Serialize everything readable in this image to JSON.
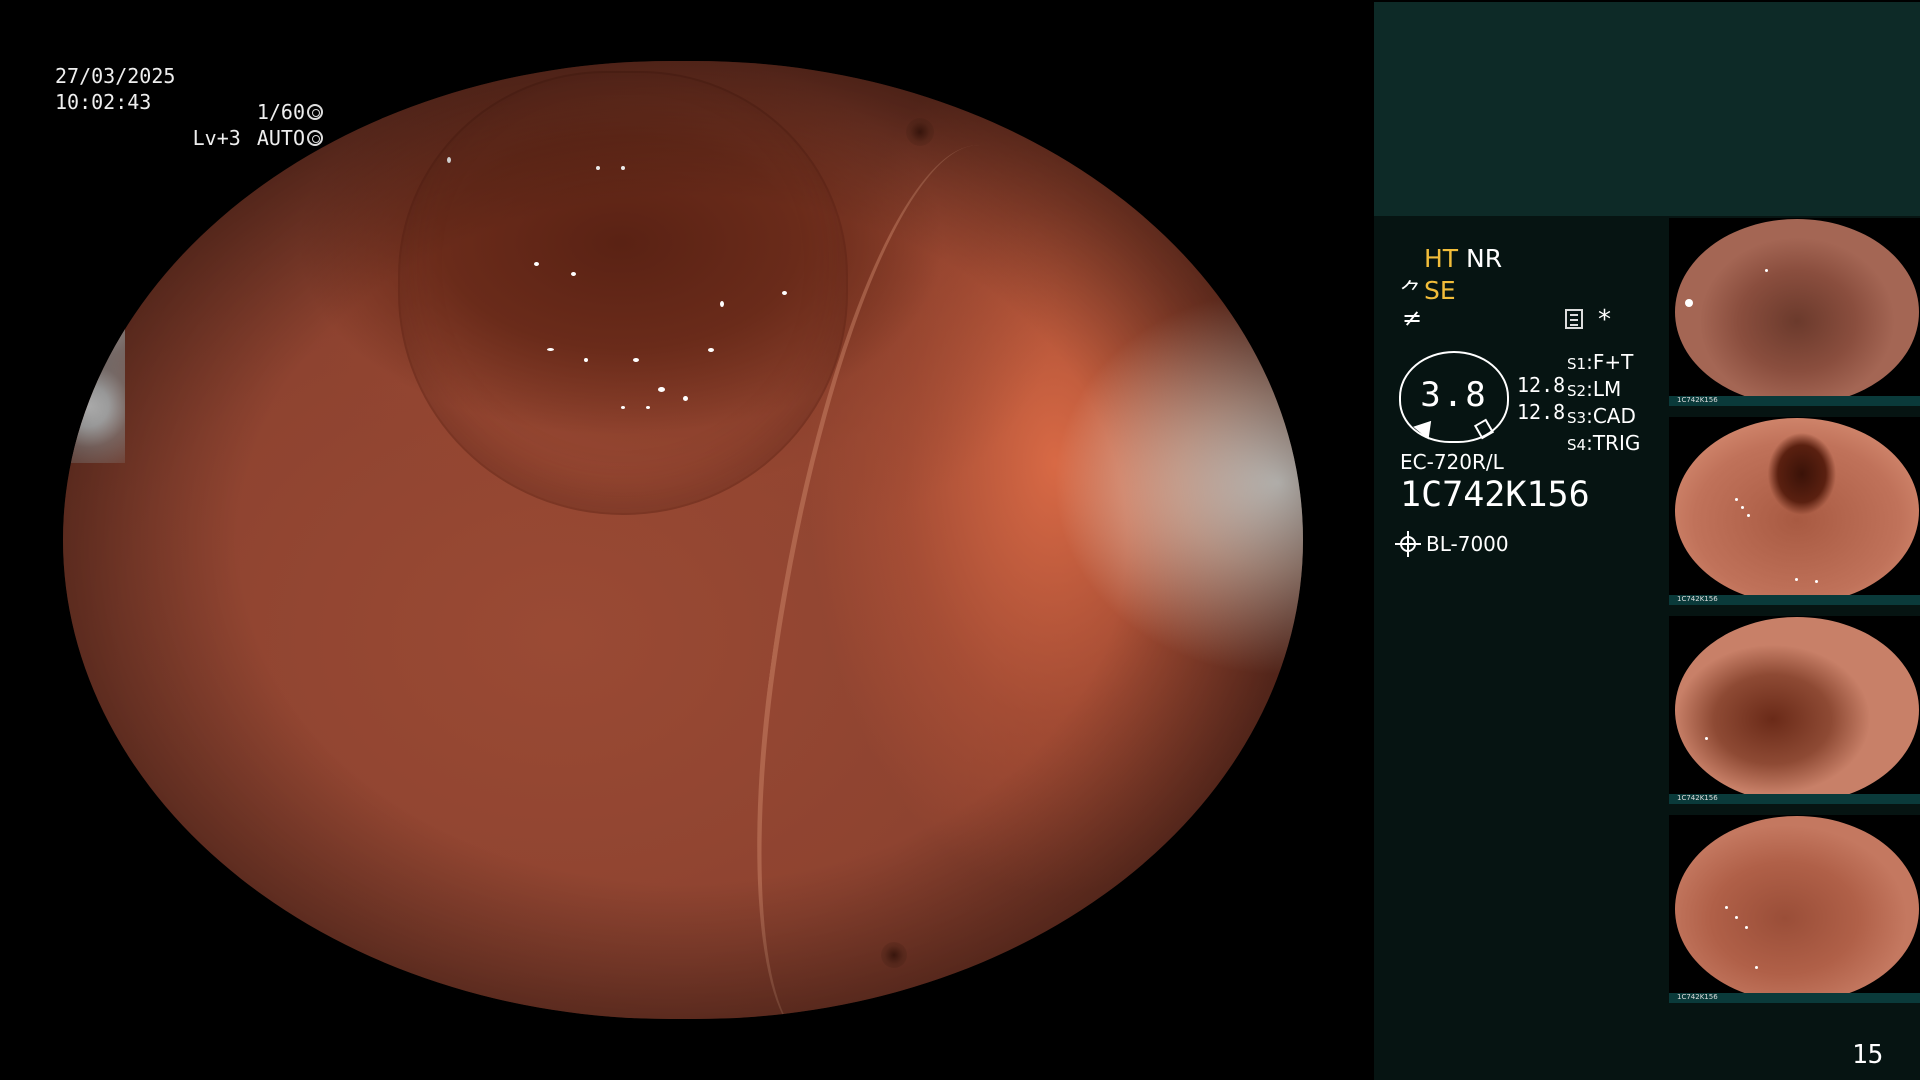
{
  "osd": {
    "date": "27/03/2025",
    "time": "10:02:43",
    "shutter": "1/60",
    "level": "Lv+3",
    "iris": "AUTO"
  },
  "panel": {
    "ht": "HT",
    "nr": "NR",
    "se": "SE",
    "se_glyph": "⺈",
    "f_glyph": "≠",
    "asterisk": "*",
    "gauge_value": "3.8",
    "gauge_nums": [
      "12.8",
      "12.8"
    ],
    "slots": [
      {
        "key": "S1",
        "value": "F+T"
      },
      {
        "key": "S2",
        "value": "LM"
      },
      {
        "key": "S3",
        "value": "CAD"
      },
      {
        "key": "S4",
        "value": "TRIG"
      }
    ],
    "scope_model": "EC-720R/L",
    "serial": "1C742K156",
    "light_source": "BL-7000",
    "page_number": "15"
  },
  "thumbnails": [
    {
      "caption": "1C742K156"
    },
    {
      "caption": "1C742K156"
    },
    {
      "caption": "1C742K156"
    },
    {
      "caption": "1C742K156"
    }
  ],
  "colors": {
    "accent_yellow": "#f2bd3a",
    "panel_bg": "#061412",
    "panel_top_bg": "#0d2a27"
  }
}
